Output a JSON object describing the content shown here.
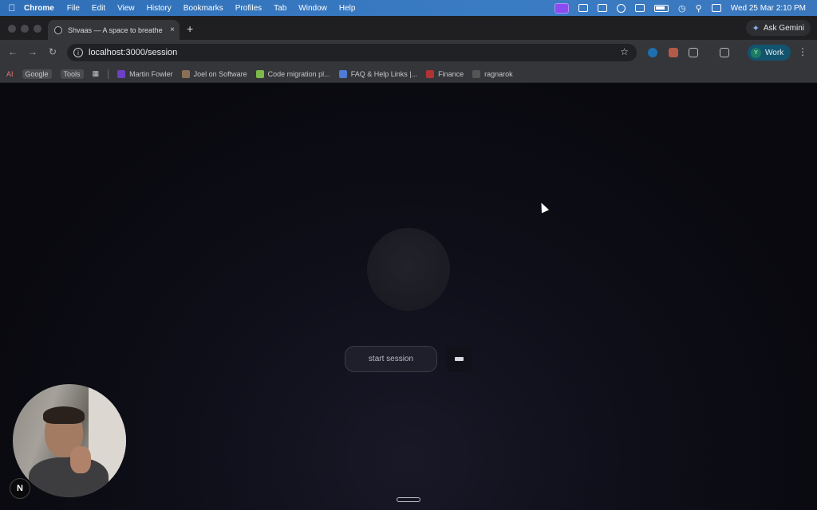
{
  "menubar": {
    "app": "Chrome",
    "items": [
      "File",
      "Edit",
      "View",
      "History",
      "Bookmarks",
      "Profiles",
      "Tab",
      "Window",
      "Help"
    ],
    "datetime": "Wed 25 Mar  2:10 PM"
  },
  "tab": {
    "title": "Shvaas — A space to breathe",
    "close": "×",
    "new_tab": "+"
  },
  "gemini": {
    "label": "Ask Gemini"
  },
  "toolbar": {
    "url": "localhost:3000/session",
    "profile_initial": "Y",
    "profile_label": "Work"
  },
  "bookmarks": {
    "ai": "AI",
    "google": "Google",
    "tools": "Tools",
    "items": [
      {
        "label": "Martin Fowler",
        "color": "#6c3fc4"
      },
      {
        "label": "Joel on Software",
        "color": "#8a6f55"
      },
      {
        "label": "Code migration pl...",
        "color": "#7db94a"
      },
      {
        "label": "FAQ & Help Links |...",
        "color": "#4d7bd6"
      },
      {
        "label": "Finance",
        "color": "#b23333"
      },
      {
        "label": "ragnarok",
        "color": "#555555"
      }
    ]
  },
  "session": {
    "start_label": "start session"
  },
  "badge": {
    "label": "N"
  }
}
